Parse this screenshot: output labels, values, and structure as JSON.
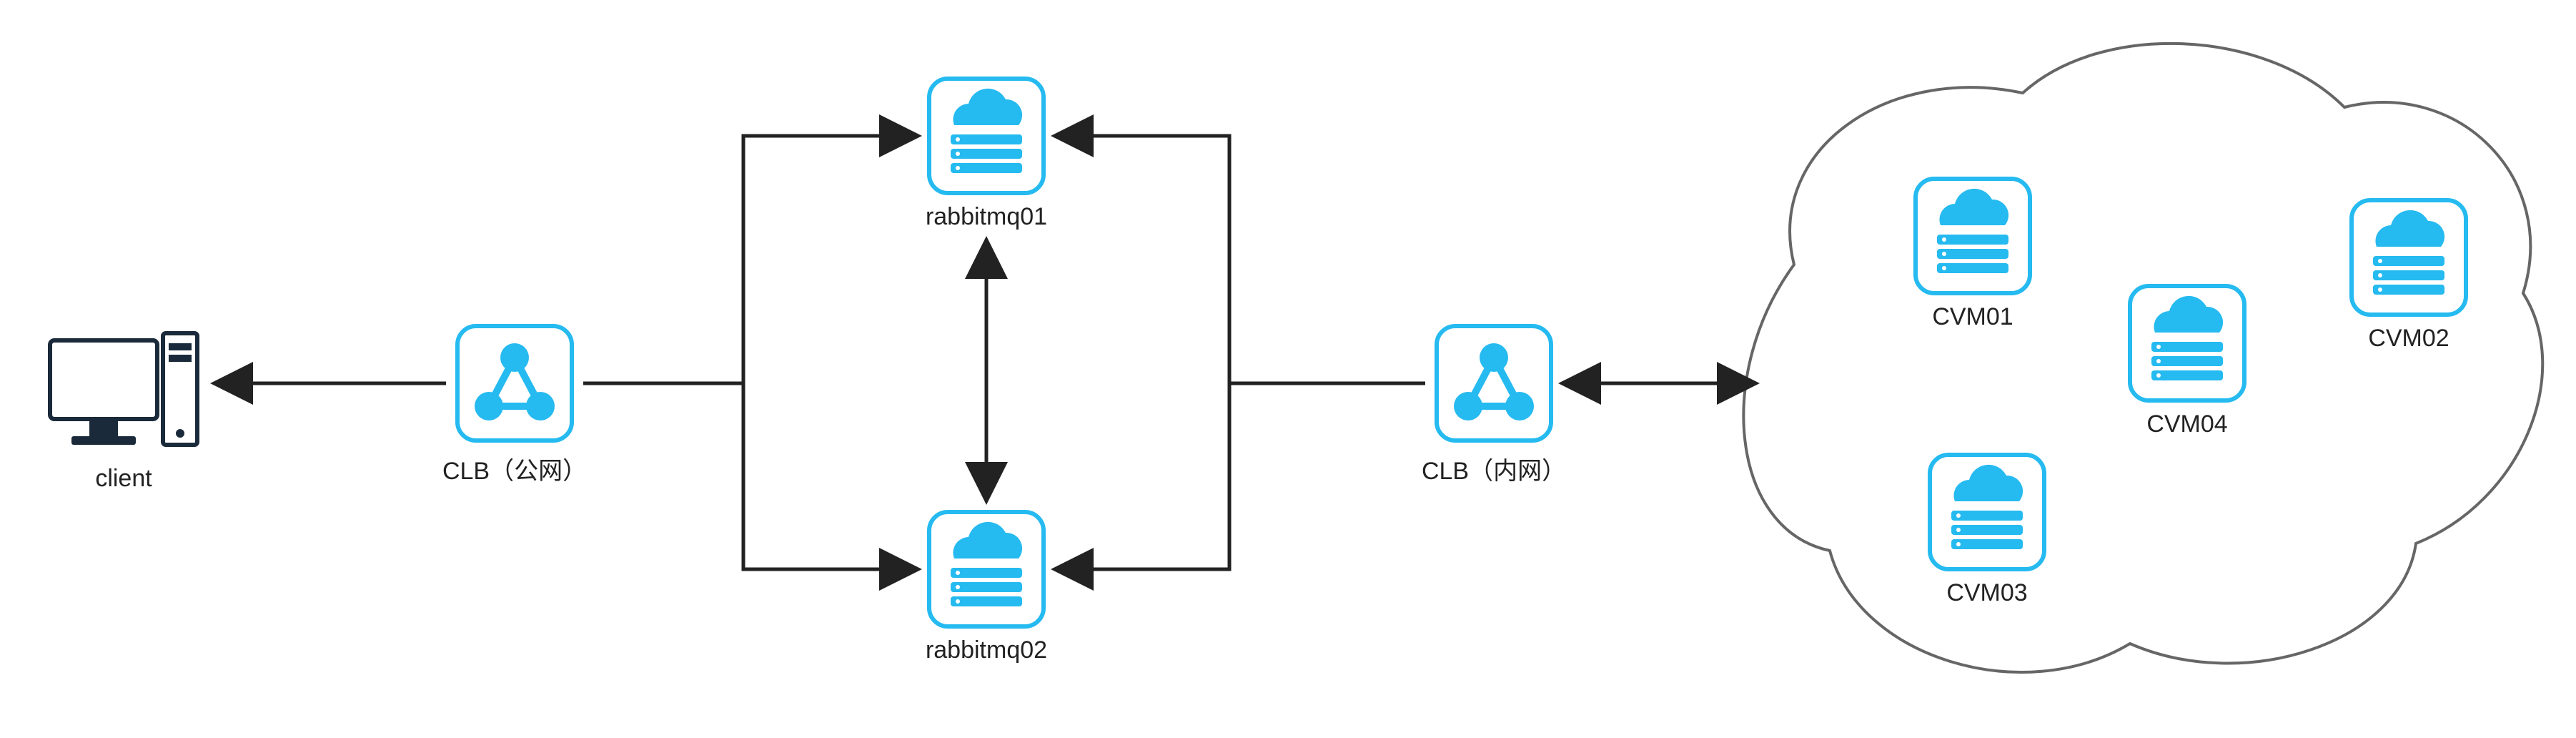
{
  "diagram": {
    "nodes": {
      "client": {
        "label": "client",
        "type": "pc"
      },
      "clb_public": {
        "label": "CLB（公网）",
        "type": "lb"
      },
      "rabbitmq01": {
        "label": "rabbitmq01",
        "type": "vm"
      },
      "rabbitmq02": {
        "label": "rabbitmq02",
        "type": "vm"
      },
      "clb_private": {
        "label": "CLB（内网）",
        "type": "lb"
      },
      "cvm01": {
        "label": "CVM01",
        "type": "vm"
      },
      "cvm02": {
        "label": "CVM02",
        "type": "vm"
      },
      "cvm03": {
        "label": "CVM03",
        "type": "vm"
      },
      "cvm04": {
        "label": "CVM04",
        "type": "vm"
      }
    },
    "edges": [
      {
        "from": "clb_public",
        "to": "client",
        "dir": "one"
      },
      {
        "from": "rabbitmq01",
        "to": "clb_public",
        "dir": "one",
        "via": "top-bus"
      },
      {
        "from": "rabbitmq02",
        "to": "clb_public",
        "dir": "one",
        "via": "bottom-bus"
      },
      {
        "from": "rabbitmq01",
        "to": "rabbitmq02",
        "dir": "both"
      },
      {
        "from": "clb_private",
        "to": "rabbitmq01",
        "dir": "one",
        "via": "top-bus"
      },
      {
        "from": "clb_private",
        "to": "rabbitmq02",
        "dir": "one",
        "via": "bottom-bus"
      },
      {
        "from": "clb_private",
        "to": "cvm_cluster",
        "dir": "both"
      }
    ],
    "groups": {
      "cvm_cluster": {
        "type": "cloud",
        "members": [
          "cvm01",
          "cvm02",
          "cvm03",
          "cvm04"
        ]
      }
    },
    "colors": {
      "icon_stroke": "#25baf0",
      "icon_fill": "#25baf0",
      "edge": "#222222",
      "cloud_stroke": "#666666"
    }
  }
}
